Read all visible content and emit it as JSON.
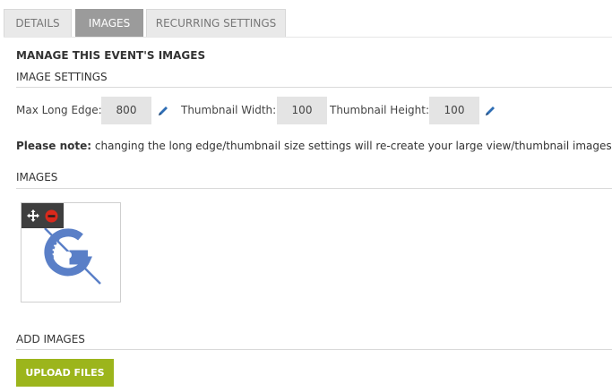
{
  "tabs": [
    {
      "label": "DETAILS",
      "active": false
    },
    {
      "label": "IMAGES",
      "active": true
    },
    {
      "label": "RECURRING SETTINGS",
      "active": false
    }
  ],
  "page_title": "MANAGE THIS EVENT'S IMAGES",
  "image_settings": {
    "heading": "IMAGE SETTINGS",
    "max_long_edge_label": "Max Long Edge:",
    "max_long_edge_value": "800",
    "thumbnail_width_label": "Thumbnail Width:",
    "thumbnail_width_value": "100",
    "thumbnail_height_label": "Thumbnail Height:",
    "thumbnail_height_value": "100",
    "edit_icon": "pencil-icon"
  },
  "note": {
    "prefix": "Please note:",
    "text": " changing the long edge/thumbnail size settings will re-create your large view/thumbnail images"
  },
  "images": {
    "heading": "IMAGES",
    "items": [
      {
        "move_icon": "move-icon",
        "remove_icon": "remove-icon"
      }
    ]
  },
  "add_images": {
    "heading": "ADD IMAGES",
    "upload_label": "UPLOAD FILES"
  },
  "colors": {
    "active_tab": "#9b9b9b",
    "inactive_tab": "#e9e9e9",
    "input_bg": "#e4e4e4",
    "upload_button": "#9cb51c",
    "edit_icon": "#2e6db4",
    "remove_icon": "#d9291c",
    "logo": "#5a7fc7"
  }
}
